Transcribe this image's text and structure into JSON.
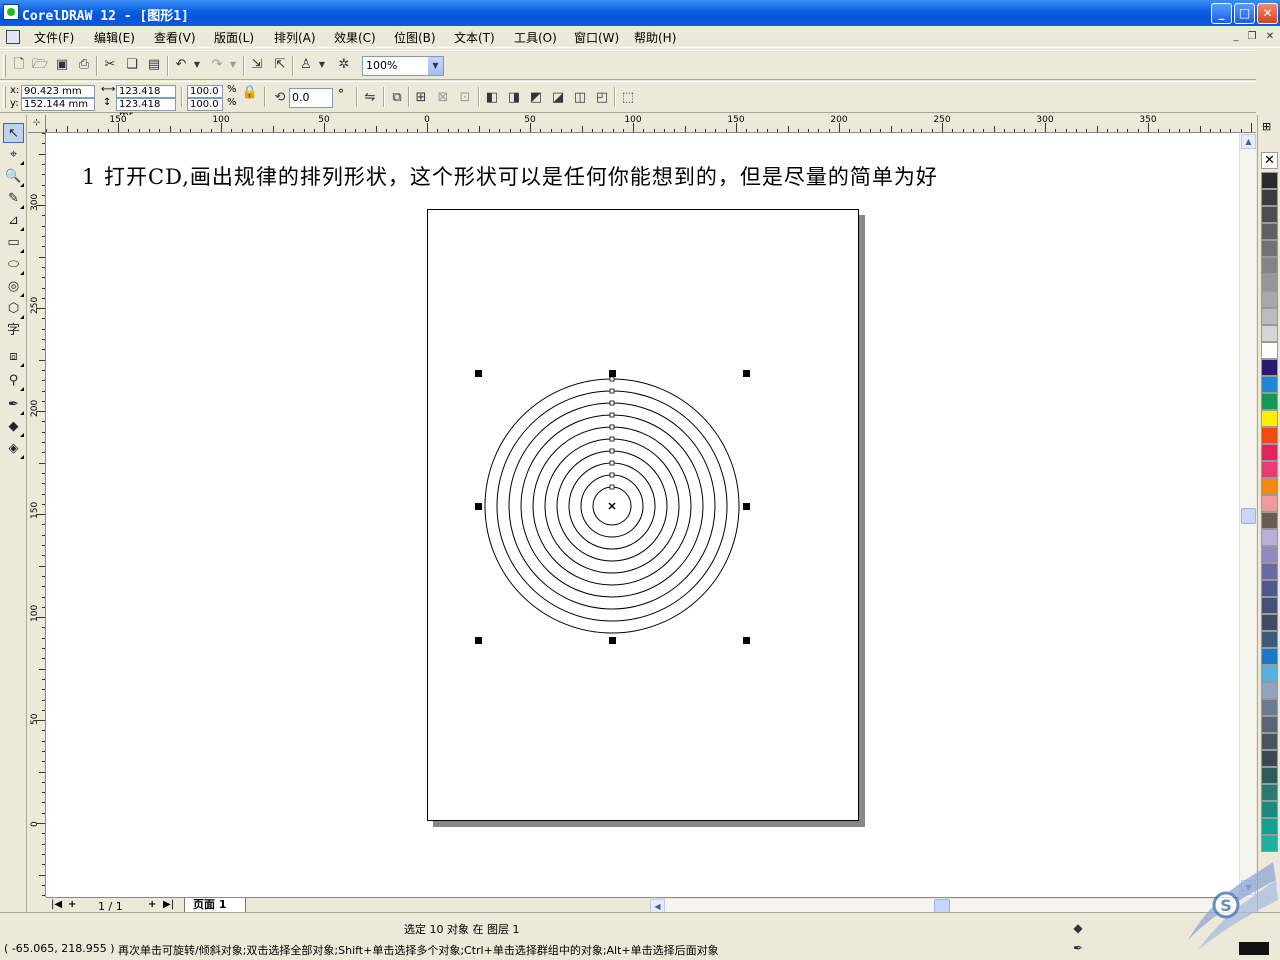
{
  "window": {
    "title": "CorelDRAW 12 - [图形1]",
    "minimize": "_",
    "maximize": "□",
    "close": "✕"
  },
  "menu": {
    "items": [
      {
        "label": "文件(F)"
      },
      {
        "label": "编辑(E)"
      },
      {
        "label": "查看(V)"
      },
      {
        "label": "版面(L)"
      },
      {
        "label": "排列(A)"
      },
      {
        "label": "效果(C)"
      },
      {
        "label": "位图(B)"
      },
      {
        "label": "文本(T)"
      },
      {
        "label": "工具(O)"
      },
      {
        "label": "窗口(W)"
      },
      {
        "label": "帮助(H)"
      }
    ]
  },
  "toolbar": {
    "zoom_value": "100%",
    "icons": [
      "new-icon",
      "open-icon",
      "save-icon",
      "print-icon",
      "cut-icon",
      "copy-icon",
      "paste-icon",
      "undo-icon",
      "redo-icon",
      "import-icon",
      "export-icon",
      "launcher-icon",
      "corel-online-icon"
    ]
  },
  "property_bar": {
    "x_label": "x:",
    "y_label": "y:",
    "x_value": "90.423 mm",
    "y_value": "152.144 mm",
    "width_value": "123.418 mr",
    "height_value": "123.418 mr",
    "scale_x": "100.0",
    "scale_y": "100.0",
    "percent": "%",
    "rotation": "0.0",
    "degree": "°"
  },
  "rulers": {
    "horizontal_labels": [
      "150",
      "100",
      "50",
      "0",
      "50",
      "100",
      "150",
      "200",
      "250",
      "300",
      "350"
    ],
    "vertical_labels": [
      "300",
      "250",
      "200",
      "150",
      "100",
      "50",
      "0"
    ]
  },
  "canvas": {
    "caption": "1 打开CD,画出规律的排列形状，这个形状可以是任何你能想到的，但是尽量的简单为好",
    "circles": 10
  },
  "page_nav": {
    "count": "1 / 1",
    "tab_label": "页面 1"
  },
  "palette": {
    "colors": [
      "#2a2a2a",
      "#3c3c3c",
      "#4e4e4e",
      "#606060",
      "#727272",
      "#848484",
      "#969696",
      "#a8a8a8",
      "#bcbcbc",
      "#d6d6d6",
      "#ffffff",
      "#2b1a6e",
      "#1e88d8",
      "#119a55",
      "#ffee00",
      "#f04a14",
      "#e0245e",
      "#e83a78",
      "#f28a12",
      "#f09aa0",
      "#6a5c52",
      "#b8b0d8",
      "#9088c0",
      "#6a6aa8",
      "#505890",
      "#445078",
      "#404a64",
      "#3c5a7c",
      "#1a78c8",
      "#5aaee0",
      "#90a4c0",
      "#6c7c90",
      "#586674",
      "#48545e",
      "#3a4a50",
      "#2c5c5c",
      "#2a7a72",
      "#1a8c7e",
      "#14a08e",
      "#20b0a0"
    ]
  },
  "status": {
    "selection": "选定 10 对象 在 图层 1",
    "coords": "( -65.065, 218.955 )",
    "hint": "再次单击可旋转/倾斜对象;双击选择全部对象;Shift+单击选择多个对象;Ctrl+单击选择群组中的对象;Alt+单击选择后面对象"
  }
}
